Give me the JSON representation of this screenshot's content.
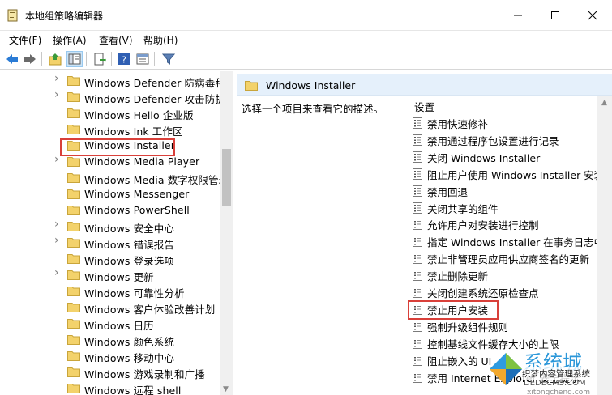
{
  "window": {
    "title": "本地组策略编辑器",
    "minimize_icon": "minimize-icon",
    "maximize_icon": "maximize-icon",
    "close_icon": "close-icon"
  },
  "menu": {
    "items": [
      "文件(F)",
      "操作(A)",
      "查看(V)",
      "帮助(H)"
    ]
  },
  "toolbar": {
    "buttons": [
      "back-arrow-icon",
      "forward-arrow-icon",
      "up-folder-icon",
      "show-hide-tree-icon",
      "export-list-icon",
      "help-icon",
      "properties-icon",
      "filter-icon"
    ]
  },
  "tree": {
    "items": [
      {
        "label": "Windows Defender 防病毒程",
        "expandable": true
      },
      {
        "label": "Windows Defender 攻击防护",
        "expandable": true
      },
      {
        "label": "Windows Hello 企业版",
        "expandable": false
      },
      {
        "label": "Windows Ink 工作区",
        "expandable": false
      },
      {
        "label": "Windows Installer",
        "expandable": false,
        "selected": true
      },
      {
        "label": "Windows Media Player",
        "expandable": true
      },
      {
        "label": "Windows Media 数字权限管理",
        "expandable": false
      },
      {
        "label": "Windows Messenger",
        "expandable": false
      },
      {
        "label": "Windows PowerShell",
        "expandable": false
      },
      {
        "label": "Windows 安全中心",
        "expandable": true
      },
      {
        "label": "Windows 错误报告",
        "expandable": true
      },
      {
        "label": "Windows 登录选项",
        "expandable": false
      },
      {
        "label": "Windows 更新",
        "expandable": true
      },
      {
        "label": "Windows 可靠性分析",
        "expandable": false
      },
      {
        "label": "Windows 客户体验改善计划",
        "expandable": false
      },
      {
        "label": "Windows 日历",
        "expandable": false
      },
      {
        "label": "Windows 颜色系统",
        "expandable": false
      },
      {
        "label": "Windows 移动中心",
        "expandable": false
      },
      {
        "label": "Windows 游戏录制和广播",
        "expandable": false
      },
      {
        "label": "Windows 远程 shell",
        "expandable": false
      }
    ]
  },
  "details": {
    "header_title": "Windows Installer",
    "description": "选择一个项目来查看它的描述。",
    "column_header": "设置",
    "settings": [
      "禁用快速修补",
      "禁用通过程序包设置进行记录",
      "关闭 Windows Installer",
      "阻止用户使用 Windows Installer 安装",
      "禁用回退",
      "关闭共享的组件",
      "允许用户对安装进行控制",
      "指定 Windows Installer 在事务日志中",
      "禁止非管理员应用供应商签名的更新",
      "禁止删除更新",
      "关闭创建系统还原检查点",
      "禁止用户安装",
      "强制升级组件规则",
      "控制基线文件缓存大小的上限",
      "阻止嵌入的 UI",
      "禁用 Internet Explorer 安全提示"
    ],
    "highlighted_setting_index": 11
  },
  "watermark": {
    "brand": "系统城",
    "line1": "织梦内容管理系统",
    "line2": "DEDECMS.COM",
    "line3": "xitongcheng.com"
  },
  "colors": {
    "highlight_border": "#d9403a",
    "header_bg": "#e5f0fb",
    "folder_yellow": "#f3d26b"
  }
}
